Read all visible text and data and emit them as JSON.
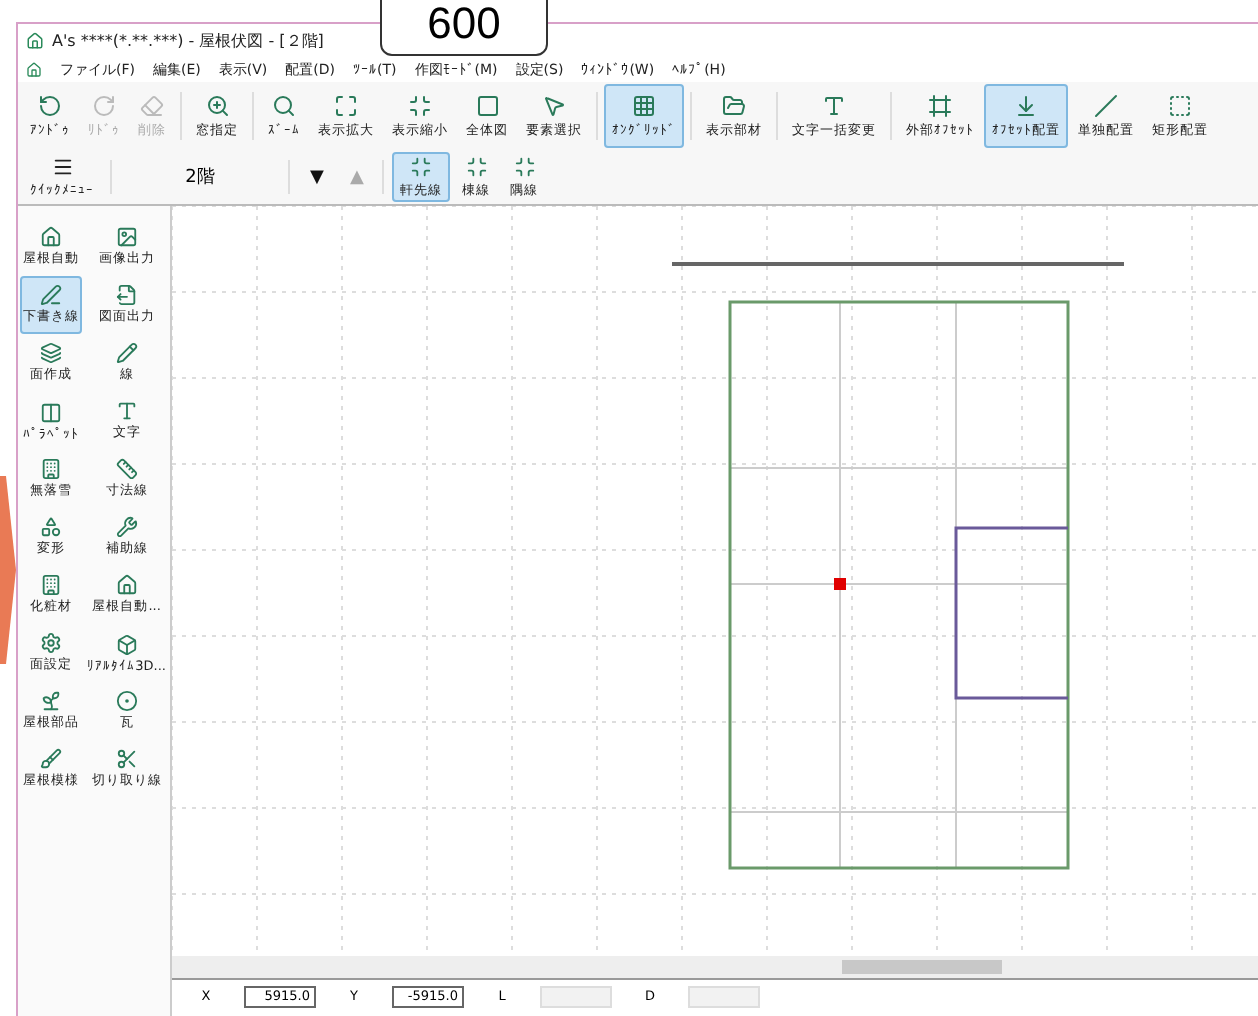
{
  "callout": {
    "text": "600"
  },
  "window": {
    "title": "A's ****(*.**.***) - 屋根伏図 - [２階]"
  },
  "menu": [
    "ファイル(F)",
    "編集(E)",
    "表示(V)",
    "配置(D)",
    "ﾂｰﾙ(T)",
    "作図ﾓｰﾄﾞ(M)",
    "設定(S)",
    "ｳｨﾝﾄﾞｳ(W)",
    "ﾍﾙﾌﾟ(H)"
  ],
  "toolbar": [
    {
      "label": "ｱﾝﾄﾞｩ",
      "selected": false,
      "disabled": false
    },
    {
      "label": "ﾘﾄﾞｩ",
      "selected": false,
      "disabled": true
    },
    {
      "label": "削除",
      "selected": false,
      "disabled": true
    },
    {
      "label": "窓指定",
      "selected": false,
      "disabled": false
    },
    {
      "label": "ｽﾞｰﾑ",
      "selected": false,
      "disabled": false
    },
    {
      "label": "表示拡大",
      "selected": false,
      "disabled": false
    },
    {
      "label": "表示縮小",
      "selected": false,
      "disabled": false
    },
    {
      "label": "全体図",
      "selected": false,
      "disabled": false
    },
    {
      "label": "要素選択",
      "selected": false,
      "disabled": false
    },
    {
      "label": "ｵﾝｸﾞﾘｯﾄﾞ",
      "selected": true,
      "disabled": false
    },
    {
      "label": "表示部材",
      "selected": false,
      "disabled": false
    },
    {
      "label": "文字一括変更",
      "selected": false,
      "disabled": false
    },
    {
      "label": "外部ｵﾌｾｯﾄ",
      "selected": false,
      "disabled": false
    },
    {
      "label": "ｵﾌｾｯﾄ配置",
      "selected": true,
      "disabled": false
    },
    {
      "label": "単独配置",
      "selected": false,
      "disabled": false
    },
    {
      "label": "矩形配置",
      "selected": false,
      "disabled": false
    }
  ],
  "quick_menu": {
    "label": "ｸｲｯｸﾒﾆｭｰ"
  },
  "floor": {
    "value": "2階",
    "down": "▼",
    "up": "▲",
    "up_disabled": true
  },
  "line_types": [
    {
      "label": "軒先線",
      "selected": true
    },
    {
      "label": "棟線",
      "selected": false
    },
    {
      "label": "隅線",
      "selected": false
    }
  ],
  "sidebar": {
    "items": [
      {
        "label": "屋根自動",
        "selected": false
      },
      {
        "label": "画像出力",
        "selected": false
      },
      {
        "label": "下書き線",
        "selected": true
      },
      {
        "label": "図面出力",
        "selected": false
      },
      {
        "label": "面作成",
        "selected": false
      },
      {
        "label": "線",
        "selected": false
      },
      {
        "label": "ﾊﾟﾗﾍﾟｯﾄ",
        "selected": false
      },
      {
        "label": "文字",
        "selected": false
      },
      {
        "label": "無落雪",
        "selected": false
      },
      {
        "label": "寸法線",
        "selected": false
      },
      {
        "label": "変形",
        "selected": false
      },
      {
        "label": "補助線",
        "selected": false
      },
      {
        "label": "化粧材",
        "selected": false
      },
      {
        "label": "屋根自動...",
        "selected": false
      },
      {
        "label": "面設定",
        "selected": false
      },
      {
        "label": "ﾘｱﾙﾀｲﾑ3D...",
        "selected": false
      },
      {
        "label": "屋根部品",
        "selected": false
      },
      {
        "label": "瓦",
        "selected": false
      },
      {
        "label": "屋根模様",
        "selected": false
      },
      {
        "label": "切り取り線",
        "selected": false
      }
    ]
  },
  "status": [
    {
      "label": "X",
      "value": "5915.0"
    },
    {
      "label": "Y",
      "value": "-5915.0"
    },
    {
      "label": "L"
    },
    {
      "label": "D"
    }
  ]
}
